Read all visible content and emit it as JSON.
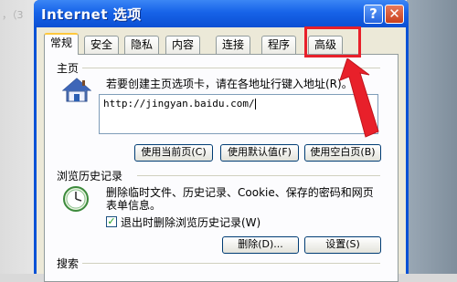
{
  "background": {
    "text": "，（3"
  },
  "window": {
    "title": "Internet 选项",
    "help_label": "?",
    "close_label": "✕"
  },
  "tabs": [
    {
      "label": "常规",
      "active": true
    },
    {
      "label": "安全",
      "active": false
    },
    {
      "label": "隐私",
      "active": false
    },
    {
      "label": "内容",
      "active": false
    },
    {
      "label": "连接",
      "active": false
    },
    {
      "label": "程序",
      "active": false
    },
    {
      "label": "高级",
      "active": false
    }
  ],
  "homepage": {
    "group_title": "主页",
    "description": "若要创建主页选项卡，请在各地址行键入地址(R)。",
    "url": "http://jingyan.baidu.com/",
    "buttons": {
      "use_current": "使用当前页(C)",
      "use_default": "使用默认值(F)",
      "use_blank": "使用空白页(B)"
    }
  },
  "history": {
    "group_title": "浏览历史记录",
    "description_line1": "删除临时文件、历史记录、Cookie、保存的密码和网页",
    "description_line2": "表单信息。",
    "checkbox_label": "退出时删除浏览历史记录(W)",
    "checkbox_checked": true,
    "buttons": {
      "delete": "删除(D)...",
      "settings": "设置(S)"
    }
  },
  "search": {
    "group_title": "搜索"
  },
  "annotation": {
    "color": "#e8202a"
  }
}
